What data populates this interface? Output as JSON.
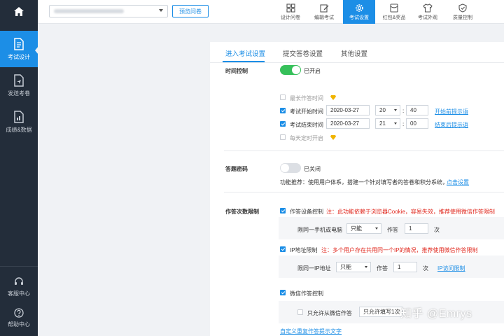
{
  "sidebar": {
    "items": [
      {
        "label": "考试设计",
        "icon": "document-edit-icon",
        "active": true
      },
      {
        "label": "发送考卷",
        "icon": "send-document-icon",
        "active": false
      },
      {
        "label": "成绩&数据",
        "icon": "chart-document-icon",
        "active": false
      }
    ],
    "bottom": [
      {
        "label": "客服中心",
        "icon": "headset-icon"
      },
      {
        "label": "帮助中心",
        "icon": "help-circle-icon"
      }
    ]
  },
  "topbar": {
    "preview_label": "预览问卷",
    "tools": [
      {
        "label": "设计问卷",
        "icon": "grid-icon"
      },
      {
        "label": "编辑考试",
        "icon": "edit-icon"
      },
      {
        "label": "考试设置",
        "icon": "gear-icon",
        "active": true
      },
      {
        "label": "红包&奖品",
        "icon": "red-packet-icon"
      },
      {
        "label": "考试外观",
        "icon": "shirt-icon"
      },
      {
        "label": "质量控制",
        "icon": "shield-icon"
      }
    ]
  },
  "tabs": {
    "enter": "进入考试设置",
    "submit": "提交答卷设置",
    "other": "其他设置"
  },
  "time_control": {
    "label": "时间控制",
    "status": "已开启",
    "max_time": "最长作答时间",
    "start_label": "考试开始时间",
    "start_date": "2020-03-27",
    "start_hour": "20",
    "start_min": "40",
    "start_link": "开始前提示语",
    "end_label": "考试结束时间",
    "end_date": "2020-03-27",
    "end_hour": "21",
    "end_min": "00",
    "end_link": "结束后提示语",
    "daily": "每天定时开启",
    "colon": ":"
  },
  "password": {
    "label": "答题密码",
    "status": "已关闭",
    "desc": "功能推荐：使用用户体系，搭建一个针对填写者的答卷和积分系统，",
    "link": "点击设置"
  },
  "limit": {
    "label": "作答次数限制",
    "device_label": "作答设备控制",
    "device_note": "注：此功能依赖于浏览器Cookie，容易失效，推荐使用微信作答限制",
    "device_row_label": "限同一手机或电脑",
    "device_select": "只能",
    "answer_word": "作答",
    "device_count": "1",
    "times_word": "次",
    "ip_label": "IP地址限制",
    "ip_note": "注：多个用户存在共用同一个IP的情况，推荐使用微信作答限制",
    "ip_row_label": "限同一IP地址",
    "ip_select": "只能",
    "ip_count": "1",
    "ip_link": "IP访问限制",
    "wechat_label": "微信作答控制",
    "wechat_only": "只允许从微信作答",
    "wechat_select": "只允许填写1次",
    "custom_link": "自定义重复作答提示文字"
  },
  "watermark": "知乎 @Emrys"
}
